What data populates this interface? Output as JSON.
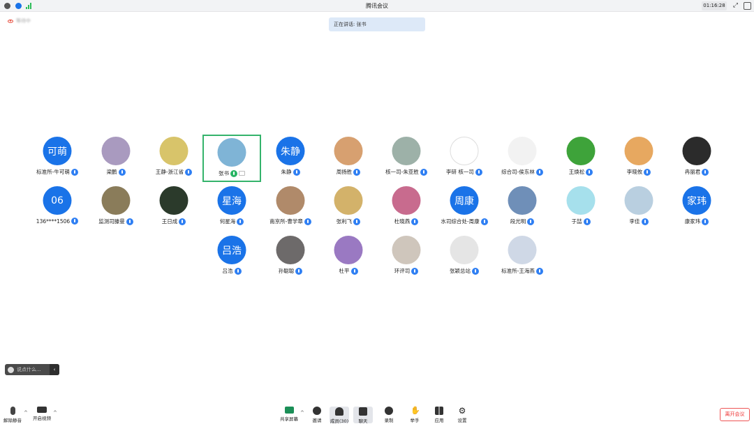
{
  "window": {
    "title": "腾讯会议",
    "timer": "01:16:28"
  },
  "recording": {
    "label": "等待中"
  },
  "speaking": {
    "label": "正在讲话: 张书"
  },
  "participants": [
    {
      "name": "标准所-牛可萌",
      "avatar_text": "可萌",
      "avatar_type": "text",
      "color": "#1a73e8"
    },
    {
      "name": "梁鹏",
      "avatar_type": "photo",
      "color": "#a99abf"
    },
    {
      "name": "王静-浙江省",
      "avatar_type": "photo",
      "color": "#d8c46a"
    },
    {
      "name": "张书",
      "avatar_type": "photo",
      "color": "#7fb4d6",
      "active": true
    },
    {
      "name": "朱静",
      "avatar_text": "朱静",
      "avatar_type": "text",
      "color": "#1a73e8"
    },
    {
      "name": "周扬胜",
      "avatar_type": "photo",
      "color": "#d7a070"
    },
    {
      "name": "核一司-朱亚胜",
      "avatar_type": "photo",
      "color": "#9db1a8"
    },
    {
      "name": "李研 核一司",
      "avatar_type": "photo",
      "color": "#ffffff"
    },
    {
      "name": "综合司-侯东林",
      "avatar_type": "photo",
      "color": "#f2f2f2"
    },
    {
      "name": "王焕松",
      "avatar_type": "photo",
      "color": "#3ea33a"
    },
    {
      "name": "李晓攸",
      "avatar_type": "photo",
      "color": "#e7a860"
    },
    {
      "name": "冉丽君",
      "avatar_type": "photo",
      "color": "#2b2b2b"
    },
    {
      "name": "136****1506",
      "avatar_text": "06",
      "avatar_type": "text",
      "color": "#1a73e8"
    },
    {
      "name": "监测司滕曼",
      "avatar_type": "photo",
      "color": "#8a7c5a"
    },
    {
      "name": "王日成",
      "avatar_type": "photo",
      "color": "#2b3a2b"
    },
    {
      "name": "何星海",
      "avatar_text": "星海",
      "avatar_type": "text",
      "color": "#1a73e8"
    },
    {
      "name": "南京所-曹学章",
      "avatar_type": "photo",
      "color": "#b08a6a"
    },
    {
      "name": "张利飞",
      "avatar_type": "photo",
      "color": "#d3b26a"
    },
    {
      "name": "杜晓燕",
      "avatar_type": "photo",
      "color": "#c86b8e"
    },
    {
      "name": "水司综合处-周康",
      "avatar_text": "周康",
      "avatar_type": "text",
      "color": "#1a73e8"
    },
    {
      "name": "段光明",
      "avatar_type": "photo",
      "color": "#6f8fb8"
    },
    {
      "name": "于喆",
      "avatar_type": "photo",
      "color": "#a6e0ec"
    },
    {
      "name": "李佳",
      "avatar_type": "photo",
      "color": "#b9cfe0"
    },
    {
      "name": "康家玮",
      "avatar_text": "家玮",
      "avatar_type": "text",
      "color": "#1a73e8"
    },
    {
      "name": "吕浩",
      "avatar_text": "吕浩",
      "avatar_type": "text",
      "color": "#1a73e8"
    },
    {
      "name": "孙聪聪",
      "avatar_type": "photo",
      "color": "#6d6a6a"
    },
    {
      "name": "杜平",
      "avatar_type": "photo",
      "color": "#9a79c2"
    },
    {
      "name": "环评司",
      "avatar_type": "photo",
      "color": "#cfc6bc"
    },
    {
      "name": "张颖总站",
      "avatar_type": "photo",
      "color": "#e5e5e5"
    },
    {
      "name": "标准所-王海燕",
      "avatar_type": "photo",
      "color": "#cfd8e6"
    }
  ],
  "chat_input": {
    "placeholder": "说点什么..."
  },
  "toolbar": {
    "unmute": "解除静音",
    "video": "开启视频",
    "share": "共享屏幕",
    "invite": "邀请",
    "members": "成员(30)",
    "chat": "聊天",
    "record": "录制",
    "raise": "举手",
    "apps": "应用",
    "settings": "设置",
    "leave": "离开会议"
  }
}
